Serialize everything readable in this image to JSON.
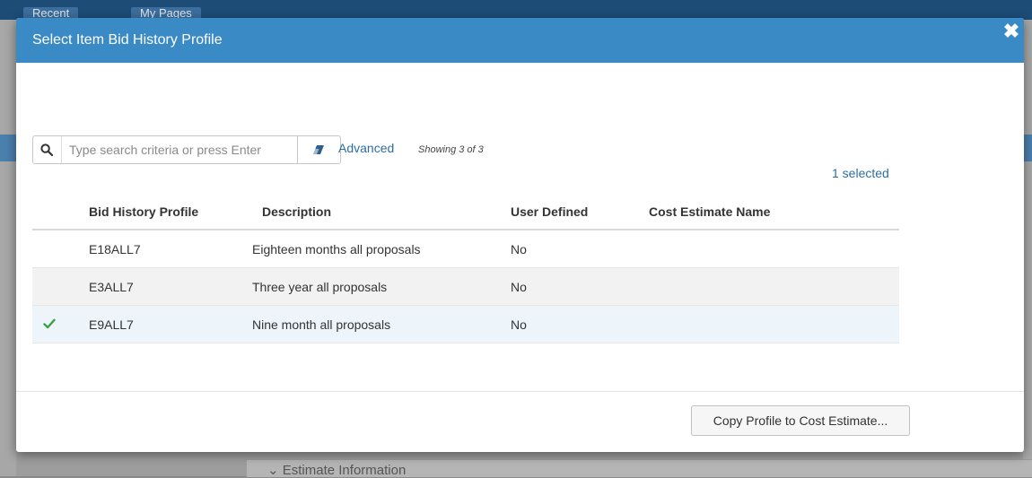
{
  "modal": {
    "title": "Select Item Bid History Profile"
  },
  "search": {
    "placeholder": "Type search criteria or press Enter",
    "value": "",
    "advanced_label": "Advanced",
    "showing_text": "Showing 3 of 3"
  },
  "selection": {
    "count_text": "1 selected"
  },
  "table": {
    "columns": [
      "Bid History Profile",
      "Description",
      "User Defined",
      "Cost Estimate Name"
    ],
    "rows": [
      {
        "profile": "E18ALL7",
        "description": "Eighteen months all proposals",
        "user_defined": "No",
        "cost_estimate_name": "",
        "selected": false
      },
      {
        "profile": "E3ALL7",
        "description": "Three year all proposals",
        "user_defined": "No",
        "cost_estimate_name": "",
        "selected": false
      },
      {
        "profile": "E9ALL7",
        "description": "Nine month all proposals",
        "user_defined": "No",
        "cost_estimate_name": "",
        "selected": true
      }
    ]
  },
  "footer": {
    "copy_button_label": "Copy Profile to Cost Estimate..."
  },
  "background": {
    "tabs": [
      "Recent",
      "My Pages"
    ],
    "section_label": "Estimate Information"
  },
  "colors": {
    "header_bg": "#3a8ac6",
    "link": "#2e6da4",
    "check": "#3aa14a"
  },
  "icons": {
    "search": "search-icon",
    "eraser": "eraser-icon",
    "check": "check-icon",
    "close": "close-icon"
  }
}
